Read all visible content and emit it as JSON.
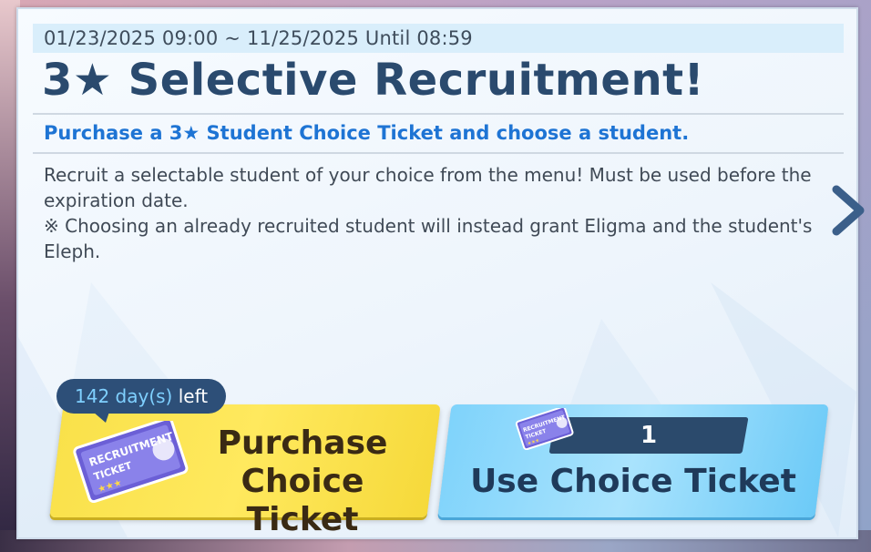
{
  "banner": {
    "date_range": "01/23/2025 09:00 ~ 11/25/2025 Until 08:59",
    "title": "3★ Selective Recruitment!",
    "subtitle": "Purchase a 3★ Student Choice Ticket and choose a student.",
    "description_lines": [
      "Recruit a selectable student of your choice from the menu! Must be used before the expiration date.",
      "※ Choosing an already recruited student will instead grant Eligma and the student's Eleph."
    ]
  },
  "navigation": {
    "next_icon": "chevron-right-icon"
  },
  "purchase": {
    "days_value": "142 day(s)",
    "days_suffix": "left",
    "label": "Purchase Choice Ticket",
    "icon": "recruitment-ticket-icon",
    "ticket_text": "RECRUITMENT TICKET"
  },
  "use": {
    "count": "1",
    "label": "Use Choice Ticket",
    "icon": "recruitment-ticket-icon",
    "ticket_text": "RECRUITMENT TICKET"
  },
  "colors": {
    "title": "#2a4a6e",
    "subtitle": "#1e74d4",
    "purchase_button": "#f9e14a",
    "use_button": "#7fd3fb",
    "badge": "#2d4f78"
  }
}
